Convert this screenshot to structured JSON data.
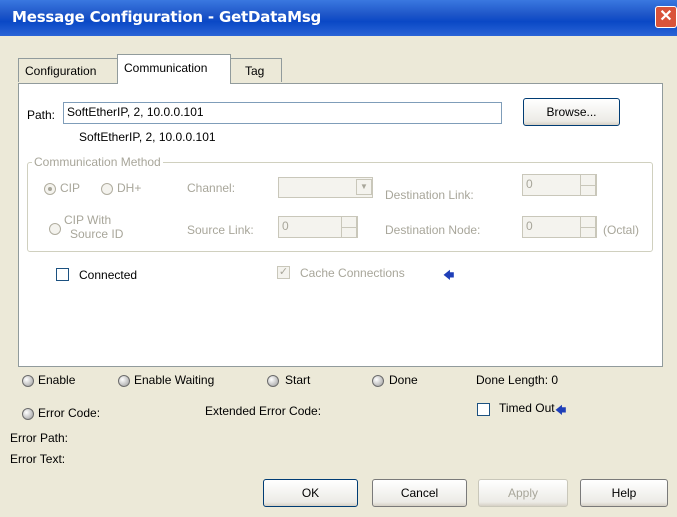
{
  "window": {
    "title": "Message Configuration - GetDataMsg",
    "close_glyph": "✕"
  },
  "tabs": [
    {
      "label": "Configuration"
    },
    {
      "label": "Communication"
    },
    {
      "label": "Tag"
    }
  ],
  "path": {
    "label": "Path:",
    "value": "SoftEtherIP, 2, 10.0.0.101",
    "resolved": "SoftEtherIP, 2, 10.0.0.101",
    "browse_label": "Browse..."
  },
  "comm_method": {
    "title": "Communication Method",
    "cip_label": "CIP",
    "dhplus_label": "DH+",
    "channel_label": "Channel:",
    "dest_link_label": "Destination Link:",
    "dest_link_value": "0",
    "cip_source_label_1": "CIP With",
    "cip_source_label_2": "Source ID",
    "source_link_label": "Source Link:",
    "source_link_value": "0",
    "dest_node_label": "Destination Node:",
    "dest_node_value": "0",
    "octal_label": "(Octal)"
  },
  "connected": {
    "label": "Connected",
    "checked": false
  },
  "cache": {
    "label": "Cache Connections",
    "checked": true,
    "arrow": "🡄"
  },
  "status": {
    "enable": "Enable",
    "enable_waiting": "Enable Waiting",
    "start": "Start",
    "done": "Done",
    "done_length": "Done Length: 0",
    "error_code": "Error Code:",
    "extended_error_code": "Extended Error Code:",
    "timed_out": "Timed Out",
    "timed_out_arrow": "🡄",
    "error_path": "Error Path:",
    "error_text": "Error Text:"
  },
  "buttons": {
    "ok": "OK",
    "cancel": "Cancel",
    "apply": "Apply",
    "help": "Help"
  },
  "colors": {
    "title_bar": "#0a48c6",
    "dialog_bg": "#ece9d8",
    "disabled_text": "#a8a69a",
    "close_button": "#d9533a"
  }
}
